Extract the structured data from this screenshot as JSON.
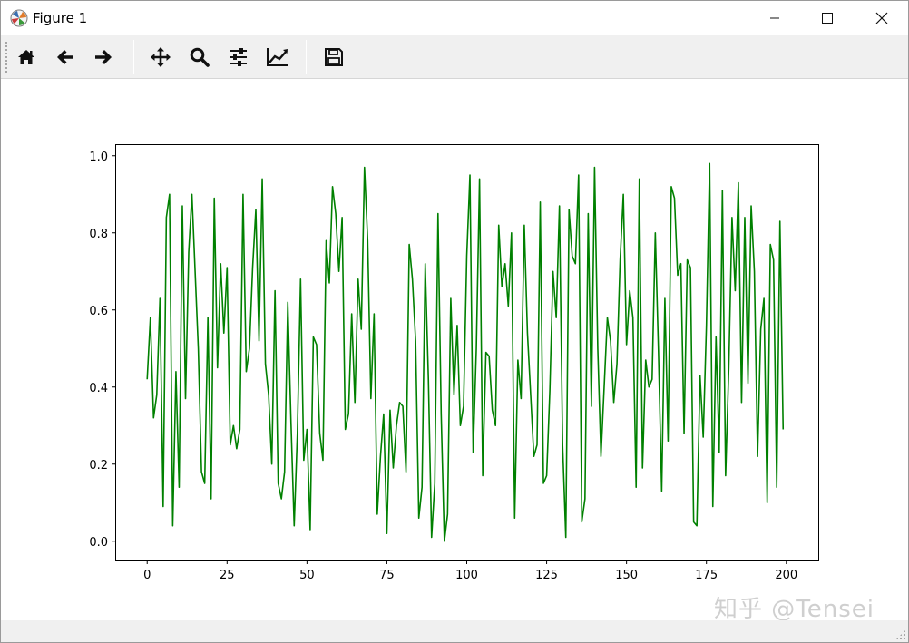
{
  "window": {
    "title": "Figure 1"
  },
  "toolbar": {
    "tools": [
      {
        "name": "home-icon",
        "tip": "Reset original view"
      },
      {
        "name": "back-arrow-icon",
        "tip": "Back"
      },
      {
        "name": "forward-arrow-icon",
        "tip": "Forward"
      },
      {
        "name": "pan-move-icon",
        "tip": "Pan"
      },
      {
        "name": "zoom-magnifier-icon",
        "tip": "Zoom"
      },
      {
        "name": "subplots-sliders-icon",
        "tip": "Configure subplots"
      },
      {
        "name": "axes-line-chart-icon",
        "tip": "Edit axis"
      },
      {
        "name": "save-floppy-icon",
        "tip": "Save the figure"
      }
    ]
  },
  "watermark": "知乎 @Tensei",
  "colors": {
    "line": "#008000",
    "toolbar_bg": "#f0f0f0"
  },
  "chart_data": {
    "type": "line",
    "title": "",
    "xlabel": "",
    "ylabel": "",
    "xlim": [
      -10,
      210
    ],
    "ylim": [
      -0.05,
      1.03
    ],
    "xticks": [
      0,
      25,
      50,
      75,
      100,
      125,
      150,
      175,
      200
    ],
    "yticks": [
      0.0,
      0.2,
      0.4,
      0.6,
      0.8,
      1.0
    ],
    "xtick_labels": [
      "0",
      "25",
      "50",
      "75",
      "100",
      "125",
      "150",
      "175",
      "200"
    ],
    "ytick_labels": [
      "0.0",
      "0.2",
      "0.4",
      "0.6",
      "0.8",
      "1.0"
    ],
    "grid": false,
    "series": [
      {
        "color": "#008000",
        "values": [
          0.42,
          0.58,
          0.32,
          0.38,
          0.63,
          0.09,
          0.84,
          0.9,
          0.04,
          0.44,
          0.14,
          0.87,
          0.37,
          0.75,
          0.9,
          0.7,
          0.5,
          0.18,
          0.15,
          0.58,
          0.11,
          0.89,
          0.45,
          0.72,
          0.54,
          0.71,
          0.25,
          0.3,
          0.24,
          0.29,
          0.9,
          0.44,
          0.5,
          0.71,
          0.86,
          0.52,
          0.94,
          0.46,
          0.38,
          0.2,
          0.65,
          0.15,
          0.11,
          0.18,
          0.62,
          0.31,
          0.04,
          0.28,
          0.68,
          0.21,
          0.29,
          0.03,
          0.53,
          0.51,
          0.28,
          0.21,
          0.78,
          0.67,
          0.92,
          0.85,
          0.7,
          0.84,
          0.29,
          0.33,
          0.59,
          0.36,
          0.68,
          0.55,
          0.97,
          0.78,
          0.37,
          0.59,
          0.07,
          0.22,
          0.33,
          0.02,
          0.34,
          0.19,
          0.3,
          0.36,
          0.35,
          0.18,
          0.77,
          0.68,
          0.52,
          0.06,
          0.14,
          0.72,
          0.42,
          0.01,
          0.15,
          0.85,
          0.33,
          0.0,
          0.07,
          0.63,
          0.38,
          0.56,
          0.3,
          0.35,
          0.74,
          0.95,
          0.23,
          0.5,
          0.94,
          0.17,
          0.49,
          0.48,
          0.34,
          0.3,
          0.82,
          0.66,
          0.72,
          0.61,
          0.8,
          0.06,
          0.47,
          0.37,
          0.82,
          0.54,
          0.38,
          0.22,
          0.25,
          0.88,
          0.15,
          0.17,
          0.39,
          0.7,
          0.58,
          0.87,
          0.25,
          0.01,
          0.86,
          0.74,
          0.72,
          0.95,
          0.05,
          0.11,
          0.85,
          0.35,
          0.97,
          0.5,
          0.22,
          0.4,
          0.58,
          0.52,
          0.36,
          0.46,
          0.73,
          0.9,
          0.51,
          0.65,
          0.58,
          0.14,
          0.94,
          0.19,
          0.47,
          0.4,
          0.42,
          0.8,
          0.49,
          0.13,
          0.63,
          0.26,
          0.92,
          0.89,
          0.69,
          0.72,
          0.28,
          0.73,
          0.71,
          0.05,
          0.04,
          0.43,
          0.27,
          0.56,
          0.98,
          0.09,
          0.53,
          0.23,
          0.91,
          0.17,
          0.45,
          0.84,
          0.65,
          0.93,
          0.36,
          0.84,
          0.41,
          0.87,
          0.7,
          0.22,
          0.55,
          0.63,
          0.1,
          0.77,
          0.73,
          0.14,
          0.83,
          0.29
        ]
      }
    ]
  }
}
